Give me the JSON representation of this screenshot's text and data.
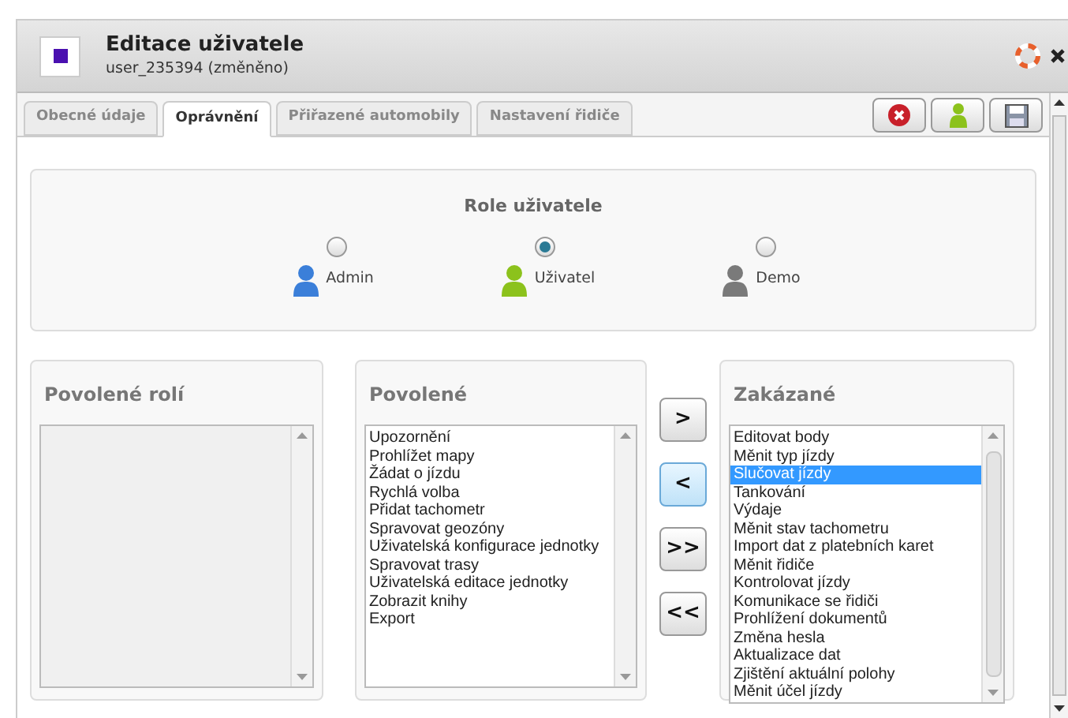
{
  "header": {
    "title": "Editace uživatele",
    "subtitle": "user_235394 (změněno)"
  },
  "tabs": [
    {
      "label": "Obecné údaje",
      "selected": false
    },
    {
      "label": "Oprávnění",
      "selected": true
    },
    {
      "label": "Přiřazené automobily",
      "selected": false
    },
    {
      "label": "Nastavení řidiče",
      "selected": false
    }
  ],
  "roles": {
    "title": "Role uživatele",
    "options": [
      {
        "label": "Admin",
        "selected": false,
        "color": "#3b7fd9"
      },
      {
        "label": "Uživatel",
        "selected": true,
        "color": "#8cc21c"
      },
      {
        "label": "Demo",
        "selected": false,
        "color": "#7a7a7a"
      }
    ]
  },
  "lists": [
    {
      "title": "Povolené rolí"
    },
    {
      "title": "Povolené",
      "items": [
        {
          "label": "Upozornění",
          "selected": false
        },
        {
          "label": "Prohlížet mapy",
          "selected": false
        },
        {
          "label": "Žádat o jízdu",
          "selected": false
        },
        {
          "label": "Rychlá volba",
          "selected": false
        },
        {
          "label": "Přidat tachometr",
          "selected": false
        },
        {
          "label": "Spravovat geozóny",
          "selected": false
        },
        {
          "label": "Uživatelská konfigurace jednotky",
          "selected": false
        },
        {
          "label": "Spravovat trasy",
          "selected": false
        },
        {
          "label": "Uživatelská editace jednotky",
          "selected": false
        },
        {
          "label": "Zobrazit knihy",
          "selected": false
        },
        {
          "label": "Export",
          "selected": false
        }
      ]
    },
    {
      "title": "Zakázané",
      "items": [
        {
          "label": "Editovat body",
          "selected": false
        },
        {
          "label": "Měnit typ jízdy",
          "selected": false
        },
        {
          "label": "Slučovat jízdy",
          "selected": true
        },
        {
          "label": "Tankování",
          "selected": false
        },
        {
          "label": "Výdaje",
          "selected": false
        },
        {
          "label": "Měnit stav tachometru",
          "selected": false
        },
        {
          "label": "Import dat z platebních karet",
          "selected": false
        },
        {
          "label": "Měnit řidiče",
          "selected": false
        },
        {
          "label": "Kontrolovat jízdy",
          "selected": false
        },
        {
          "label": "Komunikace se řidiči",
          "selected": false
        },
        {
          "label": "Prohlížení dokumentů",
          "selected": false
        },
        {
          "label": "Změna hesla",
          "selected": false
        },
        {
          "label": "Aktualizace dat",
          "selected": false
        },
        {
          "label": "Zjištění aktuální polohy",
          "selected": false
        },
        {
          "label": "Měnit účel jízdy",
          "selected": false
        }
      ]
    }
  ],
  "move_buttons": [
    {
      "label": ">",
      "active": false
    },
    {
      "label": "<",
      "active": true
    },
    {
      "label": ">>",
      "active": false
    },
    {
      "label": "<<",
      "active": false
    }
  ]
}
